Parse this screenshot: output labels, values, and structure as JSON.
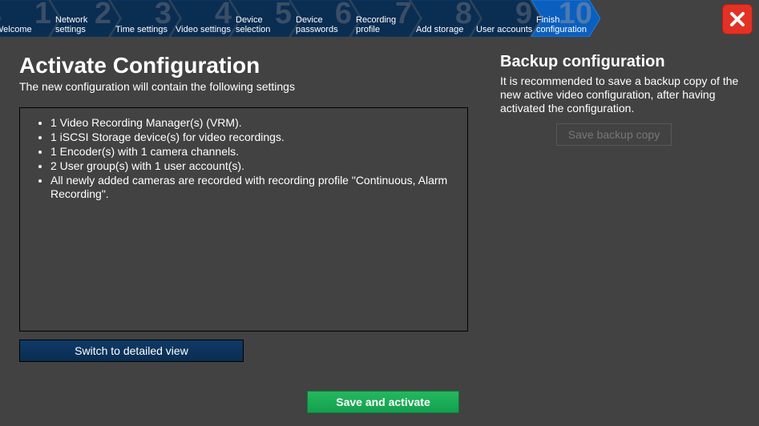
{
  "wizard": {
    "steps": [
      {
        "num": "1",
        "label": "Welcome"
      },
      {
        "num": "2",
        "label": "Network settings"
      },
      {
        "num": "3",
        "label": "Time settings"
      },
      {
        "num": "4",
        "label": "Video settings"
      },
      {
        "num": "5",
        "label": "Device selection"
      },
      {
        "num": "6",
        "label": "Device passwords"
      },
      {
        "num": "7",
        "label": "Recording profile"
      },
      {
        "num": "8",
        "label": "Add storage"
      },
      {
        "num": "9",
        "label": "User accounts"
      },
      {
        "num": "10",
        "label": "Finish configuration"
      }
    ],
    "active_index": 9
  },
  "main": {
    "title": "Activate Configuration",
    "subtitle": "The new configuration will contain the following settings",
    "summary": [
      "1 Video Recording Manager(s) (VRM).",
      "1 iSCSI Storage device(s) for video recordings.",
      "1 Encoder(s) with 1 camera channels.",
      "2 User group(s) with 1 user account(s).",
      "All newly added cameras are recorded with recording profile \"Continuous, Alarm Recording\"."
    ],
    "detail_button": "Switch to detailed view",
    "activate_button": "Save and activate"
  },
  "side": {
    "title": "Backup configuration",
    "desc": "It is recommended to save a backup copy of the new active video configuration, after having activated the configuration.",
    "backup_button": "Save backup copy"
  }
}
